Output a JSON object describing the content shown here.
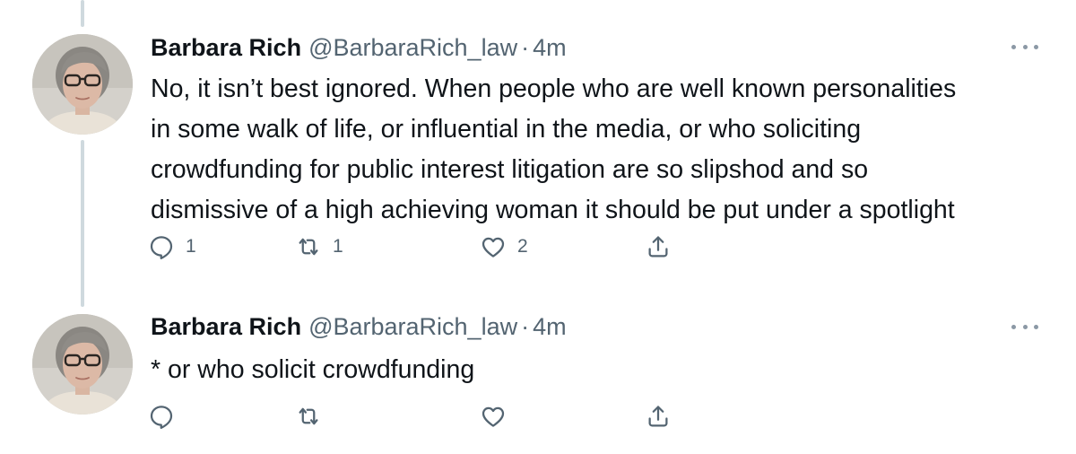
{
  "tweets": [
    {
      "author": {
        "name": "Barbara Rich",
        "handle": "@BarbaraRich_law"
      },
      "separator": "·",
      "time": "4m",
      "text_lines": [
        "No, it isn’t best ignored. When people who are well known personalities",
        "in some walk of life, or influential in the media, or who soliciting",
        "crowdfunding for public interest litigation are so slipshod and so",
        "dismissive of a high achieving woman it should be put under a spotlight"
      ],
      "counts": {
        "replies": "1",
        "retweets": "1",
        "likes": "2"
      }
    },
    {
      "author": {
        "name": "Barbara Rich",
        "handle": "@BarbaraRich_law"
      },
      "separator": "·",
      "time": "4m",
      "text_lines": [
        "* or who solicit crowdfunding"
      ],
      "counts": {
        "replies": "",
        "retweets": "",
        "likes": ""
      }
    }
  ],
  "icons": {
    "reply": "reply-icon",
    "retweet": "retweet-icon",
    "like": "heart-icon",
    "share": "share-icon",
    "more": "more-options-icon"
  },
  "colors": {
    "text": "#0f1419",
    "secondary": "#536471",
    "thread_line": "#cfd9de",
    "background": "#ffffff"
  }
}
